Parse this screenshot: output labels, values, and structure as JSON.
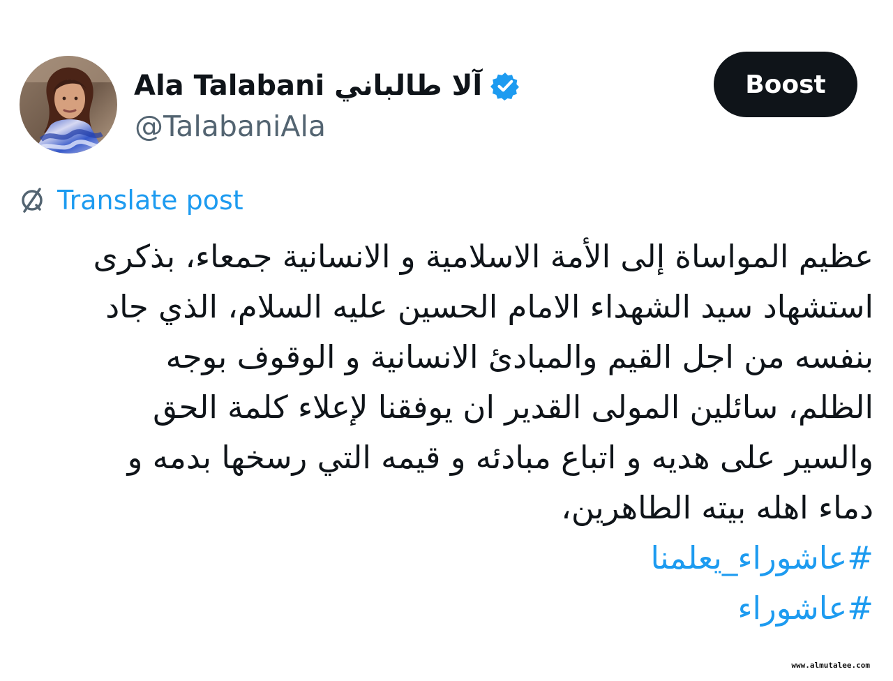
{
  "header": {
    "display_name": "Ala Talabani آلا طالباني",
    "handle": "@TalabaniAla",
    "verified_icon": "verified-badge-icon",
    "avatar_icon": "profile-photo-icon",
    "boost_label": "Boost"
  },
  "translate": {
    "icon": "translate-icon",
    "label": "Translate post"
  },
  "post": {
    "lines": [
      "عظيم المواساة إلى الأمة الاسلامية و الانسانية جمعاء، بذكرى",
      "استشهاد سيد الشهداء الامام الحسين عليه السلام، الذي جاد",
      "بنفسه من اجل القيم والمبادئ الانسانية و الوقوف بوجه",
      "الظلم، سائلين المولى القدير ان يوفقنا لإعلاء كلمة الحق",
      "والسير على هديه و اتباع مبادئه و قيمه التي رسخها بدمه و",
      "دماء اهله بيته الطاهرين،"
    ],
    "hashtags": [
      "#عاشوراء_يعلمنا",
      "#عاشوراء"
    ]
  },
  "watermark": "www.almutalee.com",
  "colors": {
    "text": "#0f1419",
    "secondary": "#536471",
    "link": "#1d9bf0",
    "button": "#0f1419"
  }
}
